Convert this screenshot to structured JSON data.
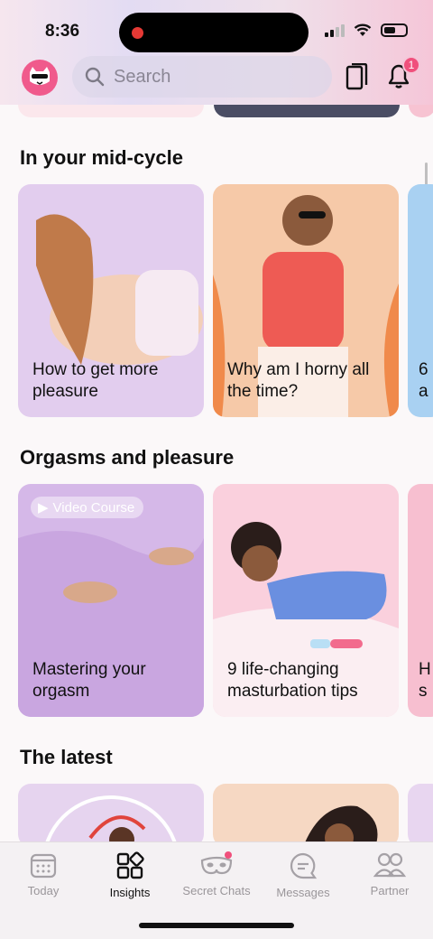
{
  "status_bar": {
    "time": "8:36"
  },
  "header": {
    "search_placeholder": "Search",
    "notification_count": "1"
  },
  "sections": [
    {
      "title": "In your mid-cycle",
      "cards": [
        {
          "label": "How to get more pleasure",
          "bg": "#e2cdee"
        },
        {
          "label": "Why am I horny all the time?",
          "bg": "#f6c9a8"
        },
        {
          "label": "6 a",
          "bg": "#a9d1f2"
        }
      ]
    },
    {
      "title": "Orgasms and pleasure",
      "cards": [
        {
          "label": "Mastering your orgasm",
          "bg": "#d5b8e8",
          "pill": "Video Course"
        },
        {
          "label": "9 life-changing masturbation tips",
          "bg": "#fad0dd"
        },
        {
          "label": "H s",
          "bg": "#f7bfd0"
        }
      ]
    },
    {
      "title": "The latest",
      "cards": [
        {
          "label": "",
          "bg": "#e6d4ef"
        },
        {
          "label": "",
          "bg": "#f6d8c3"
        },
        {
          "label": "",
          "bg": "#e8d6f0"
        }
      ]
    }
  ],
  "nav": [
    {
      "label": "Today",
      "icon": "calendar-icon",
      "active": false
    },
    {
      "label": "Insights",
      "icon": "grid-icon",
      "active": true
    },
    {
      "label": "Secret Chats",
      "icon": "mask-icon",
      "active": false
    },
    {
      "label": "Messages",
      "icon": "chat-icon",
      "active": false
    },
    {
      "label": "Partner",
      "icon": "people-icon",
      "active": false
    }
  ],
  "colors": {
    "accent": "#f0507c",
    "avatar": "#f05a8c"
  }
}
